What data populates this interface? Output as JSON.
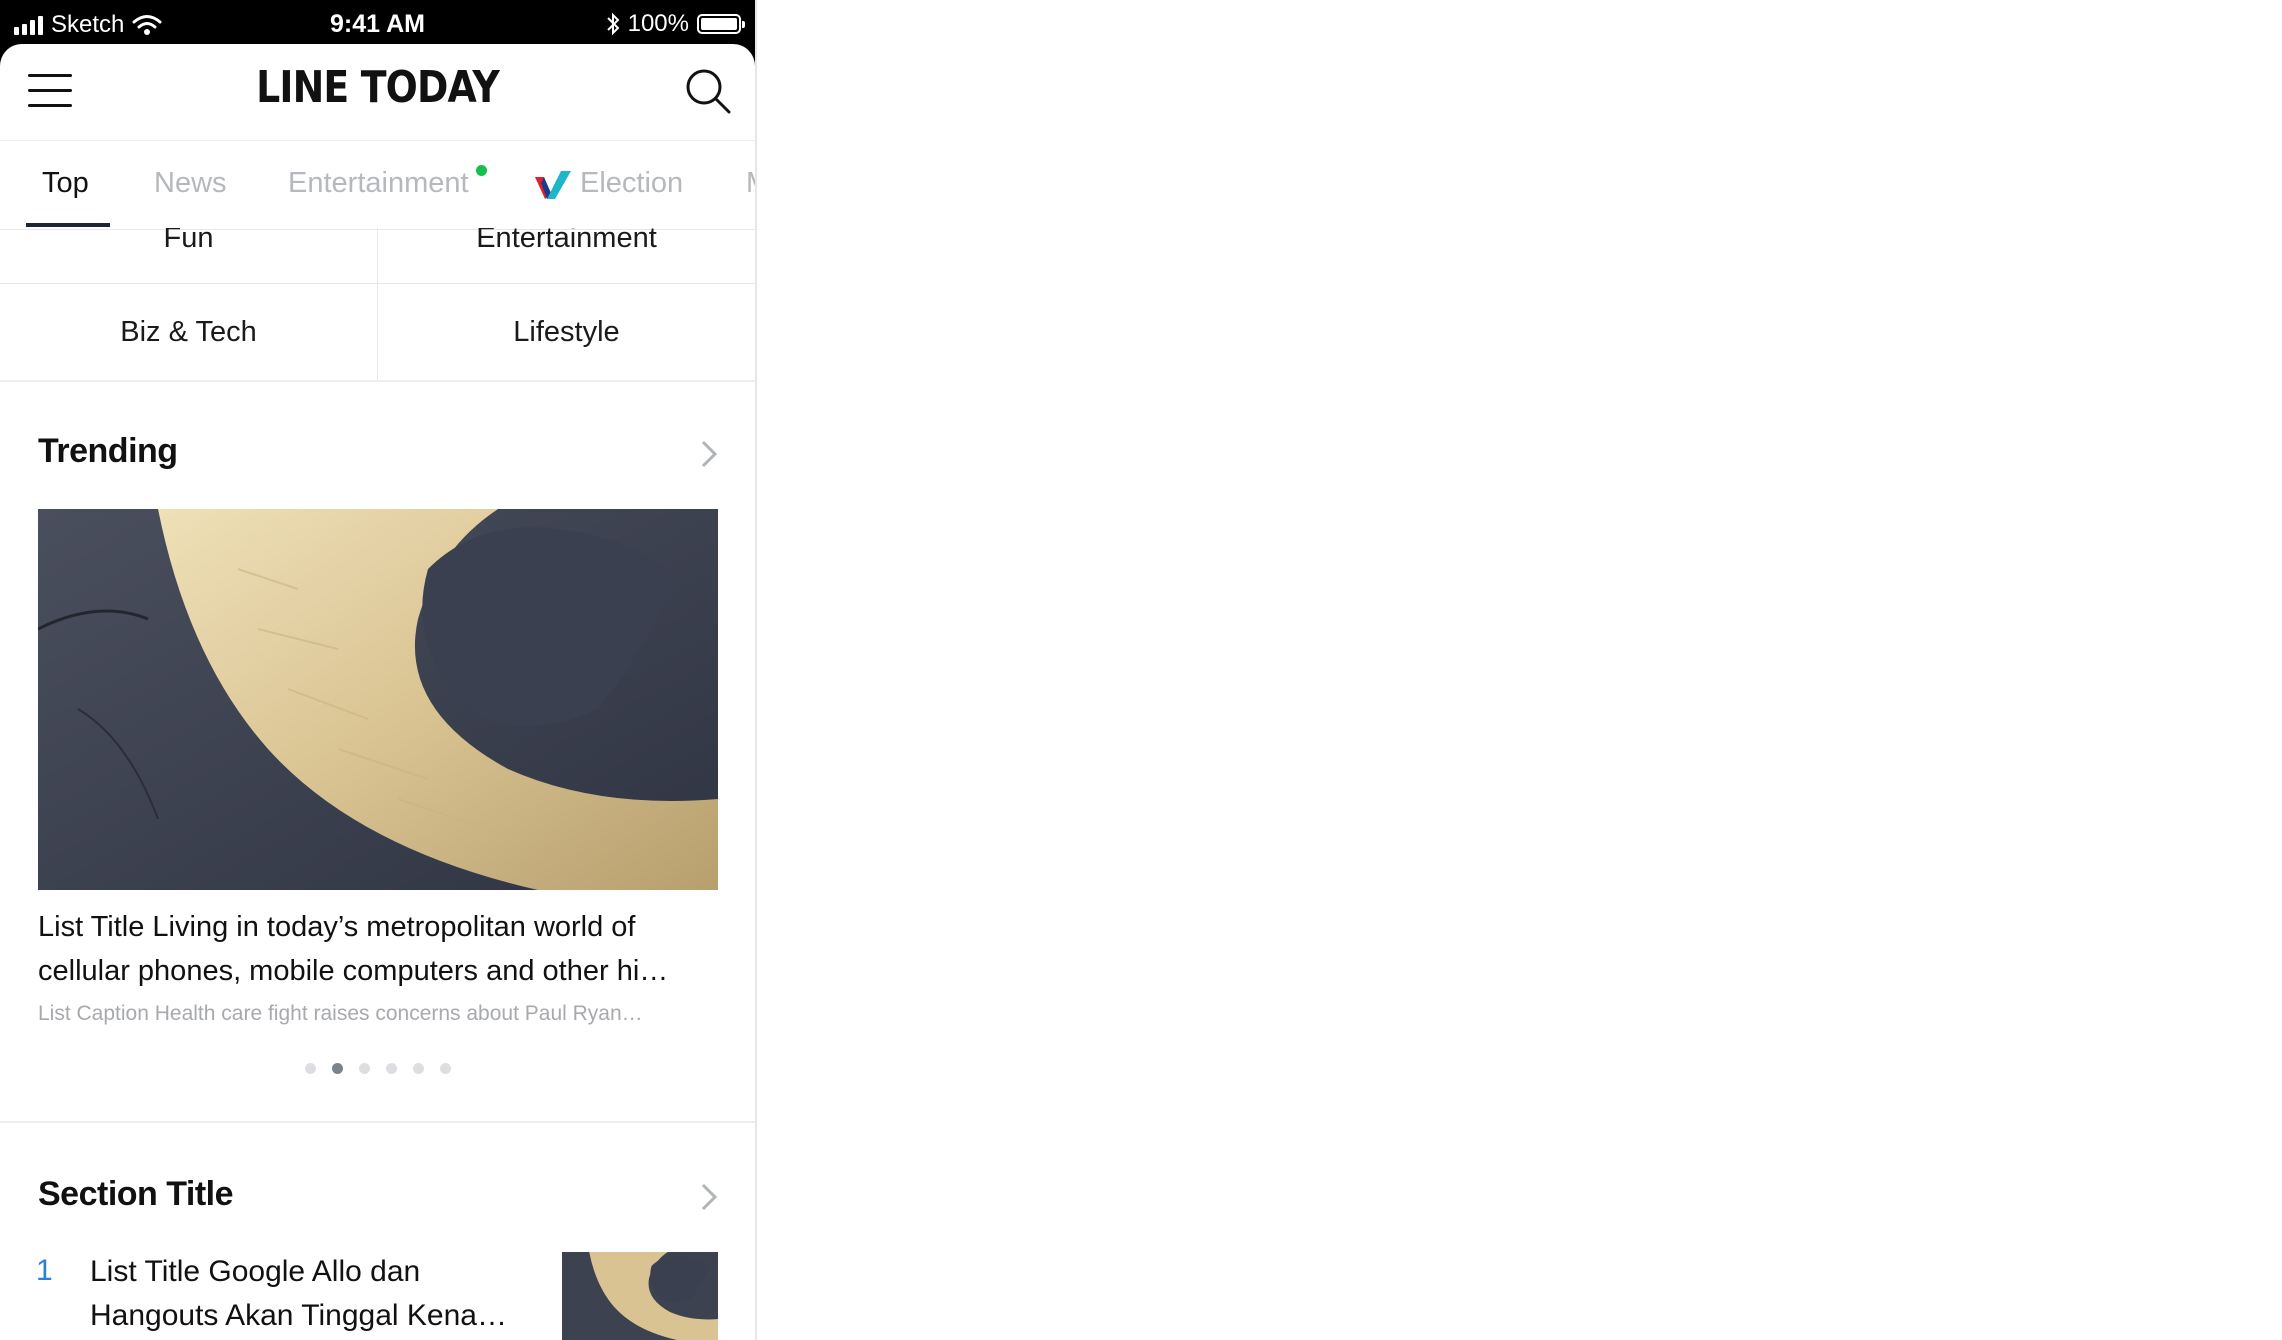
{
  "status_bar": {
    "carrier": "Sketch",
    "time": "9:41 AM",
    "battery_label": "100%",
    "icons": [
      "signal-icon",
      "wifi-icon",
      "bluetooth-icon",
      "battery-icon"
    ]
  },
  "header": {
    "logo_text": "LINE TODAY",
    "menu_icon": "hamburger-icon",
    "search_icon": "search-icon"
  },
  "tabs": [
    {
      "label": "Top",
      "active": true
    },
    {
      "label": "News",
      "active": false
    },
    {
      "label": "Entertainment",
      "active": false,
      "new_badge": true
    },
    {
      "label": "Election",
      "active": false,
      "icon": "election-check-icon"
    },
    {
      "label": "M",
      "active": false
    }
  ],
  "categories": [
    {
      "label": "Fun"
    },
    {
      "label": "Entertainment"
    },
    {
      "label": "Biz & Tech"
    },
    {
      "label": "Lifestyle"
    }
  ],
  "trending": {
    "title": "Trending",
    "list_title": "List Title Living in today’s metropolitan world of cellular phones, mobile computers and other hi…",
    "list_caption": "List Caption Health care fight raises concerns about Paul Ryan…",
    "pager": {
      "pages": 6,
      "current": 2
    }
  },
  "section": {
    "title": "Section Title",
    "items": [
      {
        "number": "1",
        "title": "List Title Google Allo dan Hangouts Akan Tinggal Kena…"
      }
    ]
  },
  "colors": {
    "accent_new": "#13c04b",
    "rank_number": "#2d7ce0",
    "tab_inactive": "#b5b8bd",
    "election_red": "#e0202d",
    "election_teal": "#1fb6c9"
  }
}
